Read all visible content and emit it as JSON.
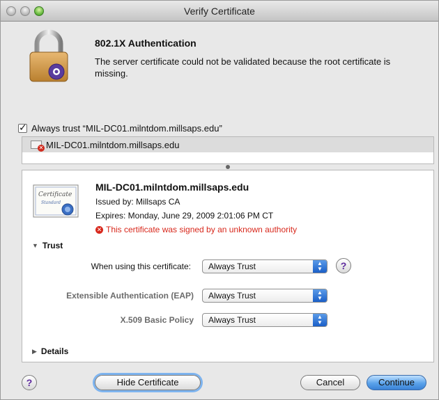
{
  "window": {
    "title": "Verify Certificate"
  },
  "header": {
    "title": "802.1X Authentication",
    "message": "The server certificate could not be validated because the root certificate is missing."
  },
  "always_trust": {
    "label": "Always trust “MIL-DC01.milntdom.millsaps.edu”",
    "checked": true
  },
  "cert_list": {
    "items": [
      {
        "name": "MIL-DC01.milntdom.millsaps.edu"
      }
    ]
  },
  "certificate": {
    "name": "MIL-DC01.milntdom.millsaps.edu",
    "issued_by": "Issued by: Millsaps CA",
    "expires": "Expires: Monday, June 29, 2009 2:01:06 PM CT",
    "warning": "This certificate was signed by an unknown authority",
    "icon_text": "Certificate",
    "icon_sub": "Standard"
  },
  "trust": {
    "header": "Trust",
    "rows": [
      {
        "label": "When using this certificate:",
        "value": "Always Trust"
      },
      {
        "label": "Extensible Authentication (EAP)",
        "value": "Always Trust"
      },
      {
        "label": "X.509 Basic Policy",
        "value": "Always Trust"
      }
    ]
  },
  "details": {
    "header": "Details"
  },
  "footer": {
    "help": "?",
    "hide_certificate": "Hide Certificate",
    "cancel": "Cancel",
    "continue": "Continue"
  },
  "icons": {
    "lock": "lock-icon",
    "warning": "x-circle-icon",
    "disclosure_open": "triangle-down-icon",
    "disclosure_closed": "triangle-right-icon"
  },
  "colors": {
    "warning": "#d8281c",
    "accent": "#3a82d6",
    "help": "#5e2a9e"
  }
}
